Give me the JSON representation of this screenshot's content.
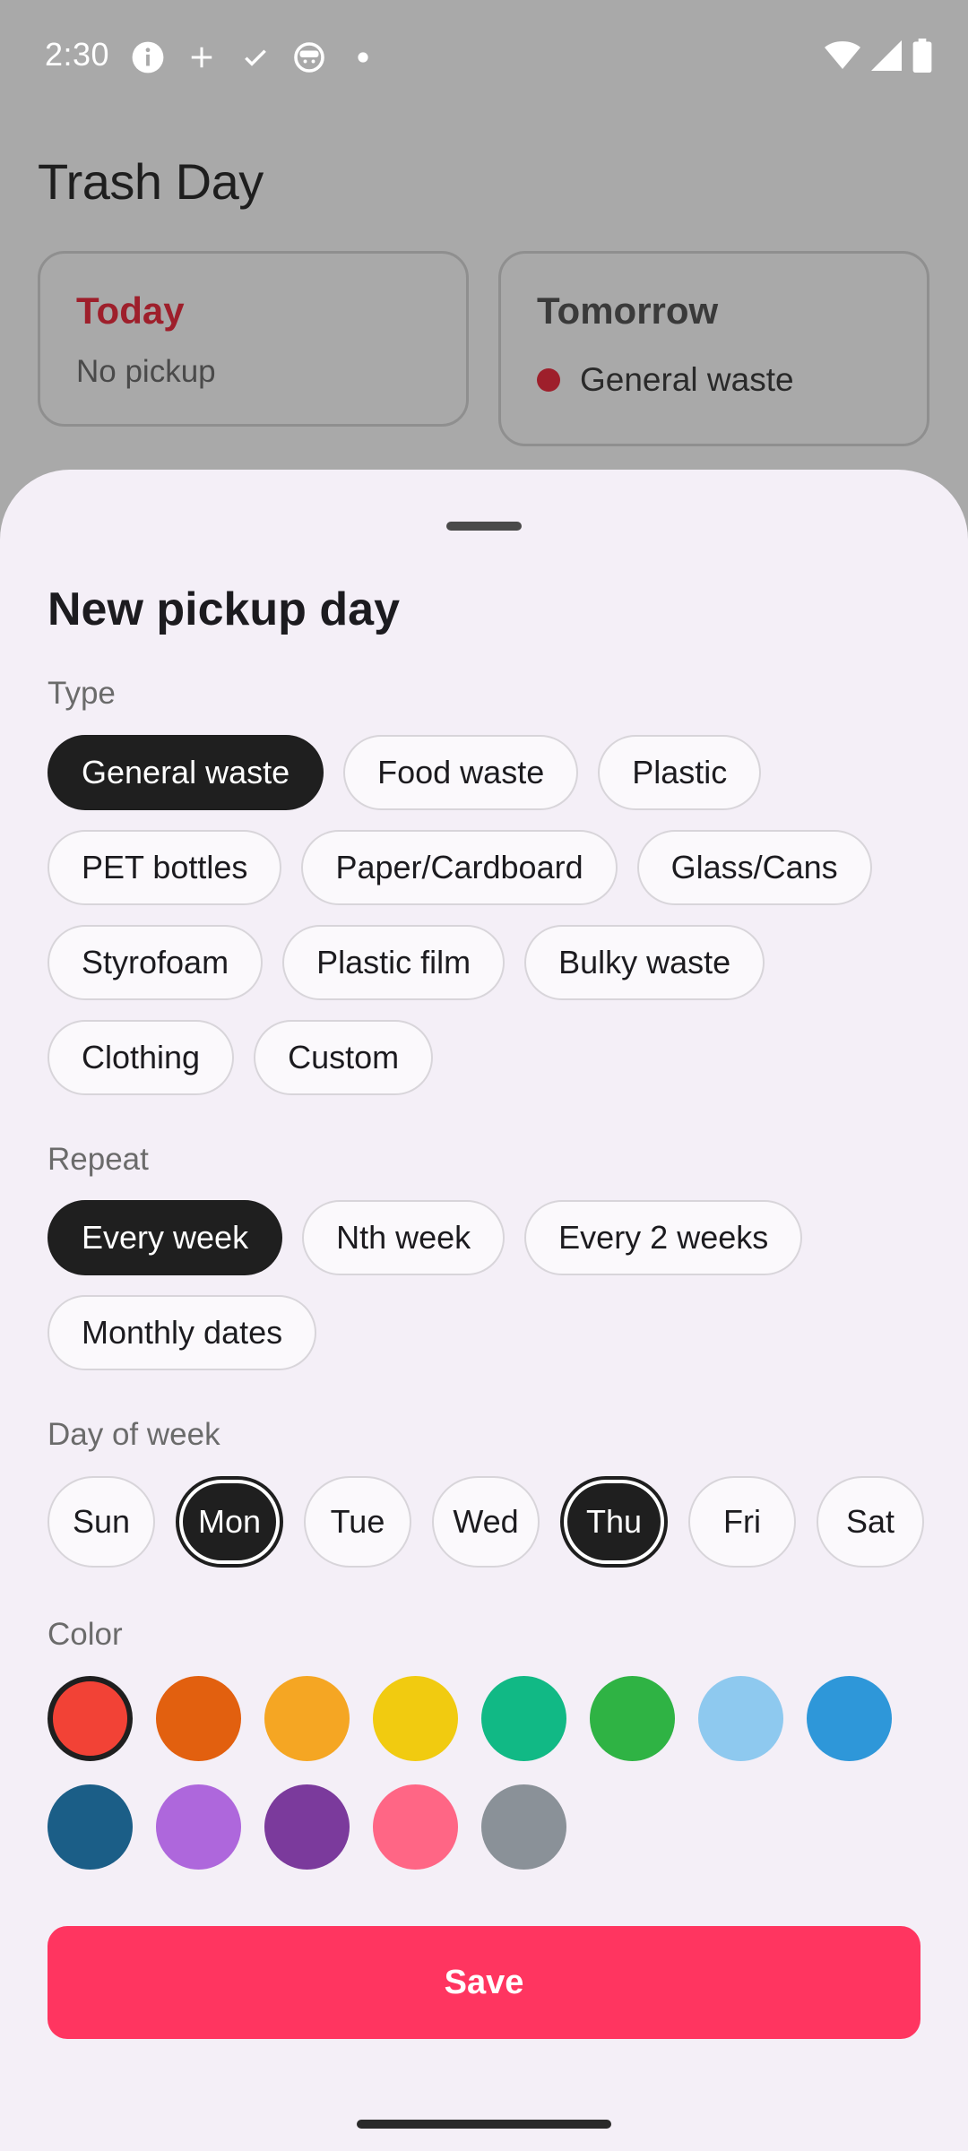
{
  "status_bar": {
    "time": "2:30",
    "left_icons": [
      "info-icon",
      "plus-icon",
      "check-icon",
      "android-icon",
      "dot-icon"
    ],
    "right_icons": [
      "wifi-icon",
      "signal-icon",
      "battery-icon"
    ]
  },
  "app": {
    "title": "Trash Day",
    "today_card": {
      "heading": "Today",
      "text": "No pickup"
    },
    "tomorrow_card": {
      "heading": "Tomorrow",
      "item": "General waste",
      "item_color": "#9e1f2b"
    }
  },
  "sheet": {
    "title": "New pickup day",
    "type": {
      "label": "Type",
      "options": [
        "General waste",
        "Food waste",
        "Plastic",
        "PET bottles",
        "Paper/Cardboard",
        "Glass/Cans",
        "Styrofoam",
        "Plastic film",
        "Bulky waste",
        "Clothing",
        "Custom"
      ],
      "selected": "General waste"
    },
    "repeat": {
      "label": "Repeat",
      "options": [
        "Every week",
        "Nth week",
        "Every 2 weeks",
        "Monthly dates"
      ],
      "selected": "Every week"
    },
    "day_of_week": {
      "label": "Day of week",
      "days": [
        "Sun",
        "Mon",
        "Tue",
        "Wed",
        "Thu",
        "Fri",
        "Sat"
      ],
      "selected": [
        "Mon",
        "Thu"
      ]
    },
    "color": {
      "label": "Color",
      "swatches": [
        "#f24236",
        "#e2600f",
        "#f5a623",
        "#f1cb10",
        "#11b985",
        "#2fb344",
        "#8ec9ef",
        "#2e97d9",
        "#1b5e87",
        "#ae67dc",
        "#7b3a9c",
        "#ff6685",
        "#8a9198"
      ],
      "selected_index": 0
    },
    "save_label": "Save"
  }
}
